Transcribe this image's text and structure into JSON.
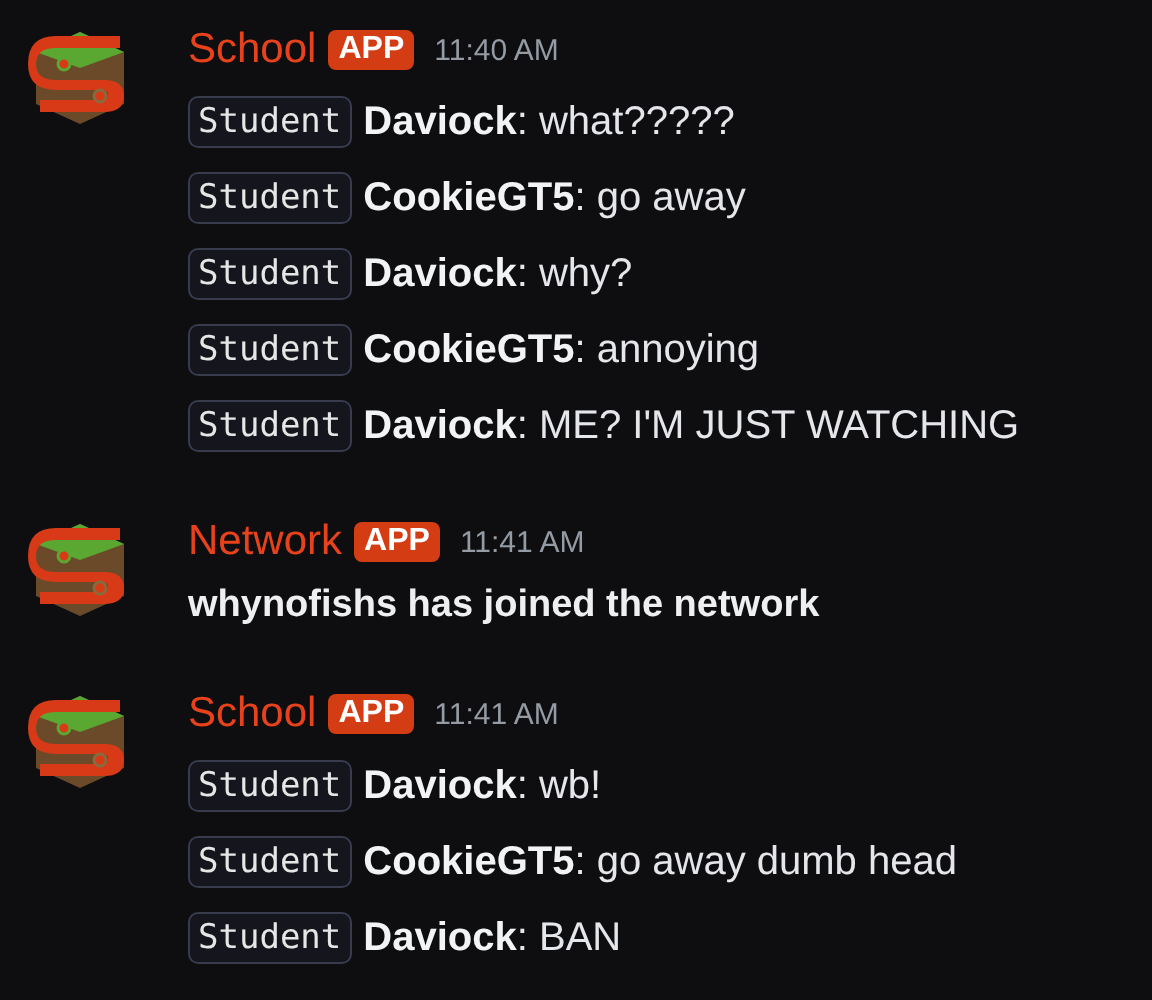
{
  "messages": [
    {
      "author": "School",
      "badge": "APP",
      "time": "11:40 AM",
      "lines": [
        {
          "kind": "chat",
          "tag": "Student",
          "text": "**Daviock**: what?????"
        },
        {
          "kind": "chat",
          "tag": "Student",
          "text": "**CookieGT5**: go away"
        },
        {
          "kind": "chat",
          "tag": "Student",
          "text": "**Daviock**: why?"
        },
        {
          "kind": "chat",
          "tag": "Student",
          "text": "**CookieGT5**: annoying"
        },
        {
          "kind": "chat",
          "tag": "Student",
          "text": "**Daviock**: ME? I'M JUST WATCHING"
        }
      ]
    },
    {
      "author": "Network",
      "badge": "APP",
      "time": "11:41 AM",
      "lines": [
        {
          "kind": "system",
          "text": "whynofishs has joined the network"
        }
      ]
    },
    {
      "author": "School",
      "badge": "APP",
      "time": "11:41 AM",
      "lines": [
        {
          "kind": "chat",
          "tag": "Student",
          "text": "**Daviock**: wb!"
        },
        {
          "kind": "chat",
          "tag": "Student",
          "text": "**CookieGT5**: go away dumb head"
        },
        {
          "kind": "chat",
          "tag": "Student",
          "text": "**Daviock**: BAN"
        }
      ]
    }
  ]
}
